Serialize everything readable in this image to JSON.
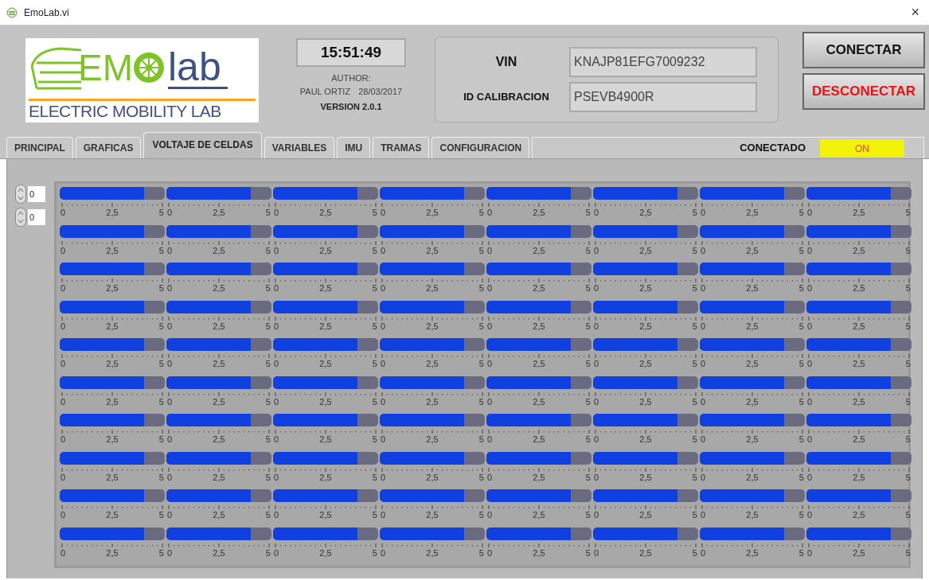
{
  "window": {
    "title": "EmoLab.vi",
    "close": "×"
  },
  "logo": {
    "mark_left": "EM",
    "mark_right": "lab",
    "tagline": "ELECTRIC MOBILITY LAB"
  },
  "info": {
    "clock": "15:51:49",
    "author_label": "AUTHOR:",
    "author": "PAUL ORTIZ",
    "date": "28/03/2017",
    "version": "VERSION 2.0.1"
  },
  "vehicle": [
    {
      "label": "VIN",
      "value": "KNAJP81EFG7009232"
    },
    {
      "label": "ID CALIBRACION",
      "value": "PSEVB4900R"
    }
  ],
  "buttons": [
    {
      "label": "CONECTAR",
      "kind": "normal"
    },
    {
      "label": "DESCONECTAR",
      "kind": "danger"
    }
  ],
  "tabs": [
    {
      "label": "PRINCIPAL",
      "selected": false
    },
    {
      "label": "GRAFICAS",
      "selected": false
    },
    {
      "label": "VOLTAJE DE CELDAS",
      "selected": true
    },
    {
      "label": "VARIABLES",
      "selected": false
    },
    {
      "label": "IMU",
      "selected": false
    },
    {
      "label": "TRAMAS",
      "selected": false
    },
    {
      "label": "CONFIGURACION",
      "selected": false
    }
  ],
  "status": {
    "label": "CONECTADO",
    "indicator": "ON",
    "on": true
  },
  "index_controls": [
    {
      "value": "0"
    },
    {
      "value": "0"
    }
  ],
  "gauges": [
    {
      "level": 0.8,
      "ticks": [
        "0",
        "2,5",
        "5"
      ]
    },
    {
      "level": 0.8,
      "ticks": [
        "0",
        "2,5",
        "5"
      ]
    },
    {
      "level": 0.8,
      "ticks": [
        "0",
        "2,5",
        "5"
      ]
    },
    {
      "level": 0.8,
      "ticks": [
        "0",
        "2,5",
        "5"
      ]
    },
    {
      "level": 0.8,
      "ticks": [
        "0",
        "2,5",
        "5"
      ]
    },
    {
      "level": 0.8,
      "ticks": [
        "0",
        "2,5",
        "5"
      ]
    },
    {
      "level": 0.8,
      "ticks": [
        "0",
        "2,5",
        "5"
      ]
    },
    {
      "level": 0.8,
      "ticks": [
        "0",
        "2,5",
        "5"
      ]
    },
    {
      "level": 0.8,
      "ticks": [
        "0",
        "2,5",
        "5"
      ]
    },
    {
      "level": 0.8,
      "ticks": [
        "0",
        "2,5",
        "5"
      ]
    },
    {
      "level": 0.8,
      "ticks": [
        "0",
        "2,5",
        "5"
      ]
    },
    {
      "level": 0.8,
      "ticks": [
        "0",
        "2,5",
        "5"
      ]
    },
    {
      "level": 0.8,
      "ticks": [
        "0",
        "2,5",
        "5"
      ]
    },
    {
      "level": 0.8,
      "ticks": [
        "0",
        "2,5",
        "5"
      ]
    },
    {
      "level": 0.8,
      "ticks": [
        "0",
        "2,5",
        "5"
      ]
    },
    {
      "level": 0.8,
      "ticks": [
        "0",
        "2,5",
        "5"
      ]
    },
    {
      "level": 0.8,
      "ticks": [
        "0",
        "2,5",
        "5"
      ]
    },
    {
      "level": 0.8,
      "ticks": [
        "0",
        "2,5",
        "5"
      ]
    },
    {
      "level": 0.8,
      "ticks": [
        "0",
        "2,5",
        "5"
      ]
    },
    {
      "level": 0.8,
      "ticks": [
        "0",
        "2,5",
        "5"
      ]
    },
    {
      "level": 0.8,
      "ticks": [
        "0",
        "2,5",
        "5"
      ]
    },
    {
      "level": 0.8,
      "ticks": [
        "0",
        "2,5",
        "5"
      ]
    },
    {
      "level": 0.8,
      "ticks": [
        "0",
        "2,5",
        "5"
      ]
    },
    {
      "level": 0.8,
      "ticks": [
        "0",
        "2,5",
        "5"
      ]
    },
    {
      "level": 0.8,
      "ticks": [
        "0",
        "2,5",
        "5"
      ]
    },
    {
      "level": 0.8,
      "ticks": [
        "0",
        "2,5",
        "5"
      ]
    },
    {
      "level": 0.8,
      "ticks": [
        "0",
        "2,5",
        "5"
      ]
    },
    {
      "level": 0.8,
      "ticks": [
        "0",
        "2,5",
        "5"
      ]
    },
    {
      "level": 0.8,
      "ticks": [
        "0",
        "2,5",
        "5"
      ]
    },
    {
      "level": 0.8,
      "ticks": [
        "0",
        "2,5",
        "5"
      ]
    },
    {
      "level": 0.8,
      "ticks": [
        "0",
        "2,5",
        "5"
      ]
    },
    {
      "level": 0.8,
      "ticks": [
        "0",
        "2,5",
        "5"
      ]
    },
    {
      "level": 0.8,
      "ticks": [
        "0",
        "2,5",
        "5"
      ]
    },
    {
      "level": 0.8,
      "ticks": [
        "0",
        "2,5",
        "5"
      ]
    },
    {
      "level": 0.8,
      "ticks": [
        "0",
        "2,5",
        "5"
      ]
    },
    {
      "level": 0.8,
      "ticks": [
        "0",
        "2,5",
        "5"
      ]
    },
    {
      "level": 0.8,
      "ticks": [
        "0",
        "2,5",
        "5"
      ]
    },
    {
      "level": 0.8,
      "ticks": [
        "0",
        "2,5",
        "5"
      ]
    },
    {
      "level": 0.8,
      "ticks": [
        "0",
        "2,5",
        "5"
      ]
    },
    {
      "level": 0.8,
      "ticks": [
        "0",
        "2,5",
        "5"
      ]
    },
    {
      "level": 0.8,
      "ticks": [
        "0",
        "2,5",
        "5"
      ]
    },
    {
      "level": 0.8,
      "ticks": [
        "0",
        "2,5",
        "5"
      ]
    },
    {
      "level": 0.8,
      "ticks": [
        "0",
        "2,5",
        "5"
      ]
    },
    {
      "level": 0.8,
      "ticks": [
        "0",
        "2,5",
        "5"
      ]
    },
    {
      "level": 0.8,
      "ticks": [
        "0",
        "2,5",
        "5"
      ]
    },
    {
      "level": 0.8,
      "ticks": [
        "0",
        "2,5",
        "5"
      ]
    },
    {
      "level": 0.8,
      "ticks": [
        "0",
        "2,5",
        "5"
      ]
    },
    {
      "level": 0.8,
      "ticks": [
        "0",
        "2,5",
        "5"
      ]
    },
    {
      "level": 0.8,
      "ticks": [
        "0",
        "2,5",
        "5"
      ]
    },
    {
      "level": 0.8,
      "ticks": [
        "0",
        "2,5",
        "5"
      ]
    },
    {
      "level": 0.8,
      "ticks": [
        "0",
        "2,5",
        "5"
      ]
    },
    {
      "level": 0.8,
      "ticks": [
        "0",
        "2,5",
        "5"
      ]
    },
    {
      "level": 0.8,
      "ticks": [
        "0",
        "2,5",
        "5"
      ]
    },
    {
      "level": 0.8,
      "ticks": [
        "0",
        "2,5",
        "5"
      ]
    },
    {
      "level": 0.8,
      "ticks": [
        "0",
        "2,5",
        "5"
      ]
    },
    {
      "level": 0.8,
      "ticks": [
        "0",
        "2,5",
        "5"
      ]
    },
    {
      "level": 0.8,
      "ticks": [
        "0",
        "2,5",
        "5"
      ]
    },
    {
      "level": 0.8,
      "ticks": [
        "0",
        "2,5",
        "5"
      ]
    },
    {
      "level": 0.8,
      "ticks": [
        "0",
        "2,5",
        "5"
      ]
    },
    {
      "level": 0.8,
      "ticks": [
        "0",
        "2,5",
        "5"
      ]
    },
    {
      "level": 0.8,
      "ticks": [
        "0",
        "2,5",
        "5"
      ]
    },
    {
      "level": 0.8,
      "ticks": [
        "0",
        "2,5",
        "5"
      ]
    },
    {
      "level": 0.8,
      "ticks": [
        "0",
        "2,5",
        "5"
      ]
    },
    {
      "level": 0.8,
      "ticks": [
        "0",
        "2,5",
        "5"
      ]
    },
    {
      "level": 0.8,
      "ticks": [
        "0",
        "2,5",
        "5"
      ]
    },
    {
      "level": 0.8,
      "ticks": [
        "0",
        "2,5",
        "5"
      ]
    },
    {
      "level": 0.8,
      "ticks": [
        "0",
        "2,5",
        "5"
      ]
    },
    {
      "level": 0.8,
      "ticks": [
        "0",
        "2,5",
        "5"
      ]
    },
    {
      "level": 0.8,
      "ticks": [
        "0",
        "2,5",
        "5"
      ]
    },
    {
      "level": 0.8,
      "ticks": [
        "0",
        "2,5",
        "5"
      ]
    },
    {
      "level": 0.8,
      "ticks": [
        "0",
        "2,5",
        "5"
      ]
    },
    {
      "level": 0.8,
      "ticks": [
        "0",
        "2,5",
        "5"
      ]
    },
    {
      "level": 0.8,
      "ticks": [
        "0",
        "2,5",
        "5"
      ]
    },
    {
      "level": 0.8,
      "ticks": [
        "0",
        "2,5",
        "5"
      ]
    },
    {
      "level": 0.8,
      "ticks": [
        "0",
        "2,5",
        "5"
      ]
    },
    {
      "level": 0.8,
      "ticks": [
        "0",
        "2,5",
        "5"
      ]
    },
    {
      "level": 0.8,
      "ticks": [
        "0",
        "2,5",
        "5"
      ]
    },
    {
      "level": 0.8,
      "ticks": [
        "0",
        "2,5",
        "5"
      ]
    },
    {
      "level": 0.8,
      "ticks": [
        "0",
        "2,5",
        "5"
      ]
    },
    {
      "level": 0.8,
      "ticks": [
        "0",
        "2,5",
        "5"
      ]
    }
  ]
}
